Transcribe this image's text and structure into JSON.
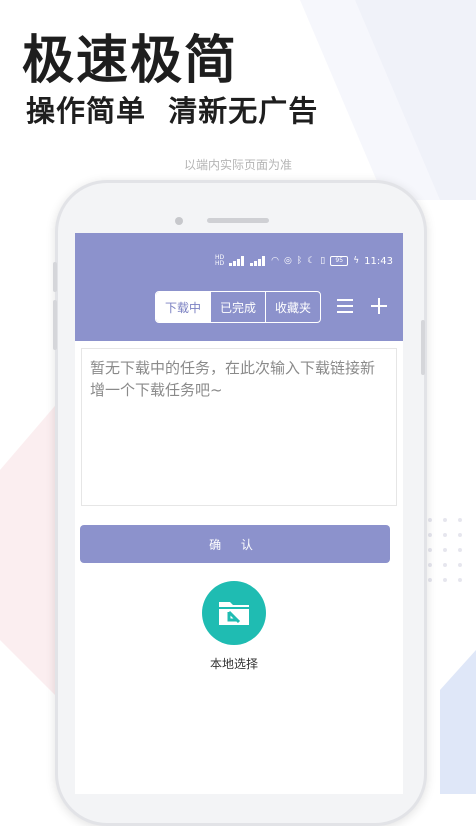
{
  "colors": {
    "accent": "#8c92cc",
    "teal": "#1fbcb2",
    "headline": "#1e1e1e"
  },
  "promo": {
    "headline": "极速极简",
    "subline": "操作简单  清新无广告",
    "note": "以端内实际页面为准"
  },
  "status_bar": {
    "time": "11:43",
    "battery": "95",
    "icons": [
      "hd-icon",
      "signal-icon",
      "signal-icon",
      "wifi-icon",
      "nfc-icon",
      "bluetooth-icon",
      "moon-icon",
      "vibrate-icon",
      "battery-icon",
      "charging-icon"
    ]
  },
  "tabs": [
    {
      "label": "下载中",
      "active": true
    },
    {
      "label": "已完成",
      "active": false
    },
    {
      "label": "收藏夹",
      "active": false
    }
  ],
  "toolbar": {
    "menu_icon": "menu-icon",
    "add_icon": "plus-icon"
  },
  "input": {
    "placeholder": "暂无下载中的任务，在此次输入下载链接新增一个下载任务吧~",
    "value": ""
  },
  "confirm_button": {
    "label": "确 认"
  },
  "local_select": {
    "icon": "folder-arrow-icon",
    "label": "本地选择"
  }
}
